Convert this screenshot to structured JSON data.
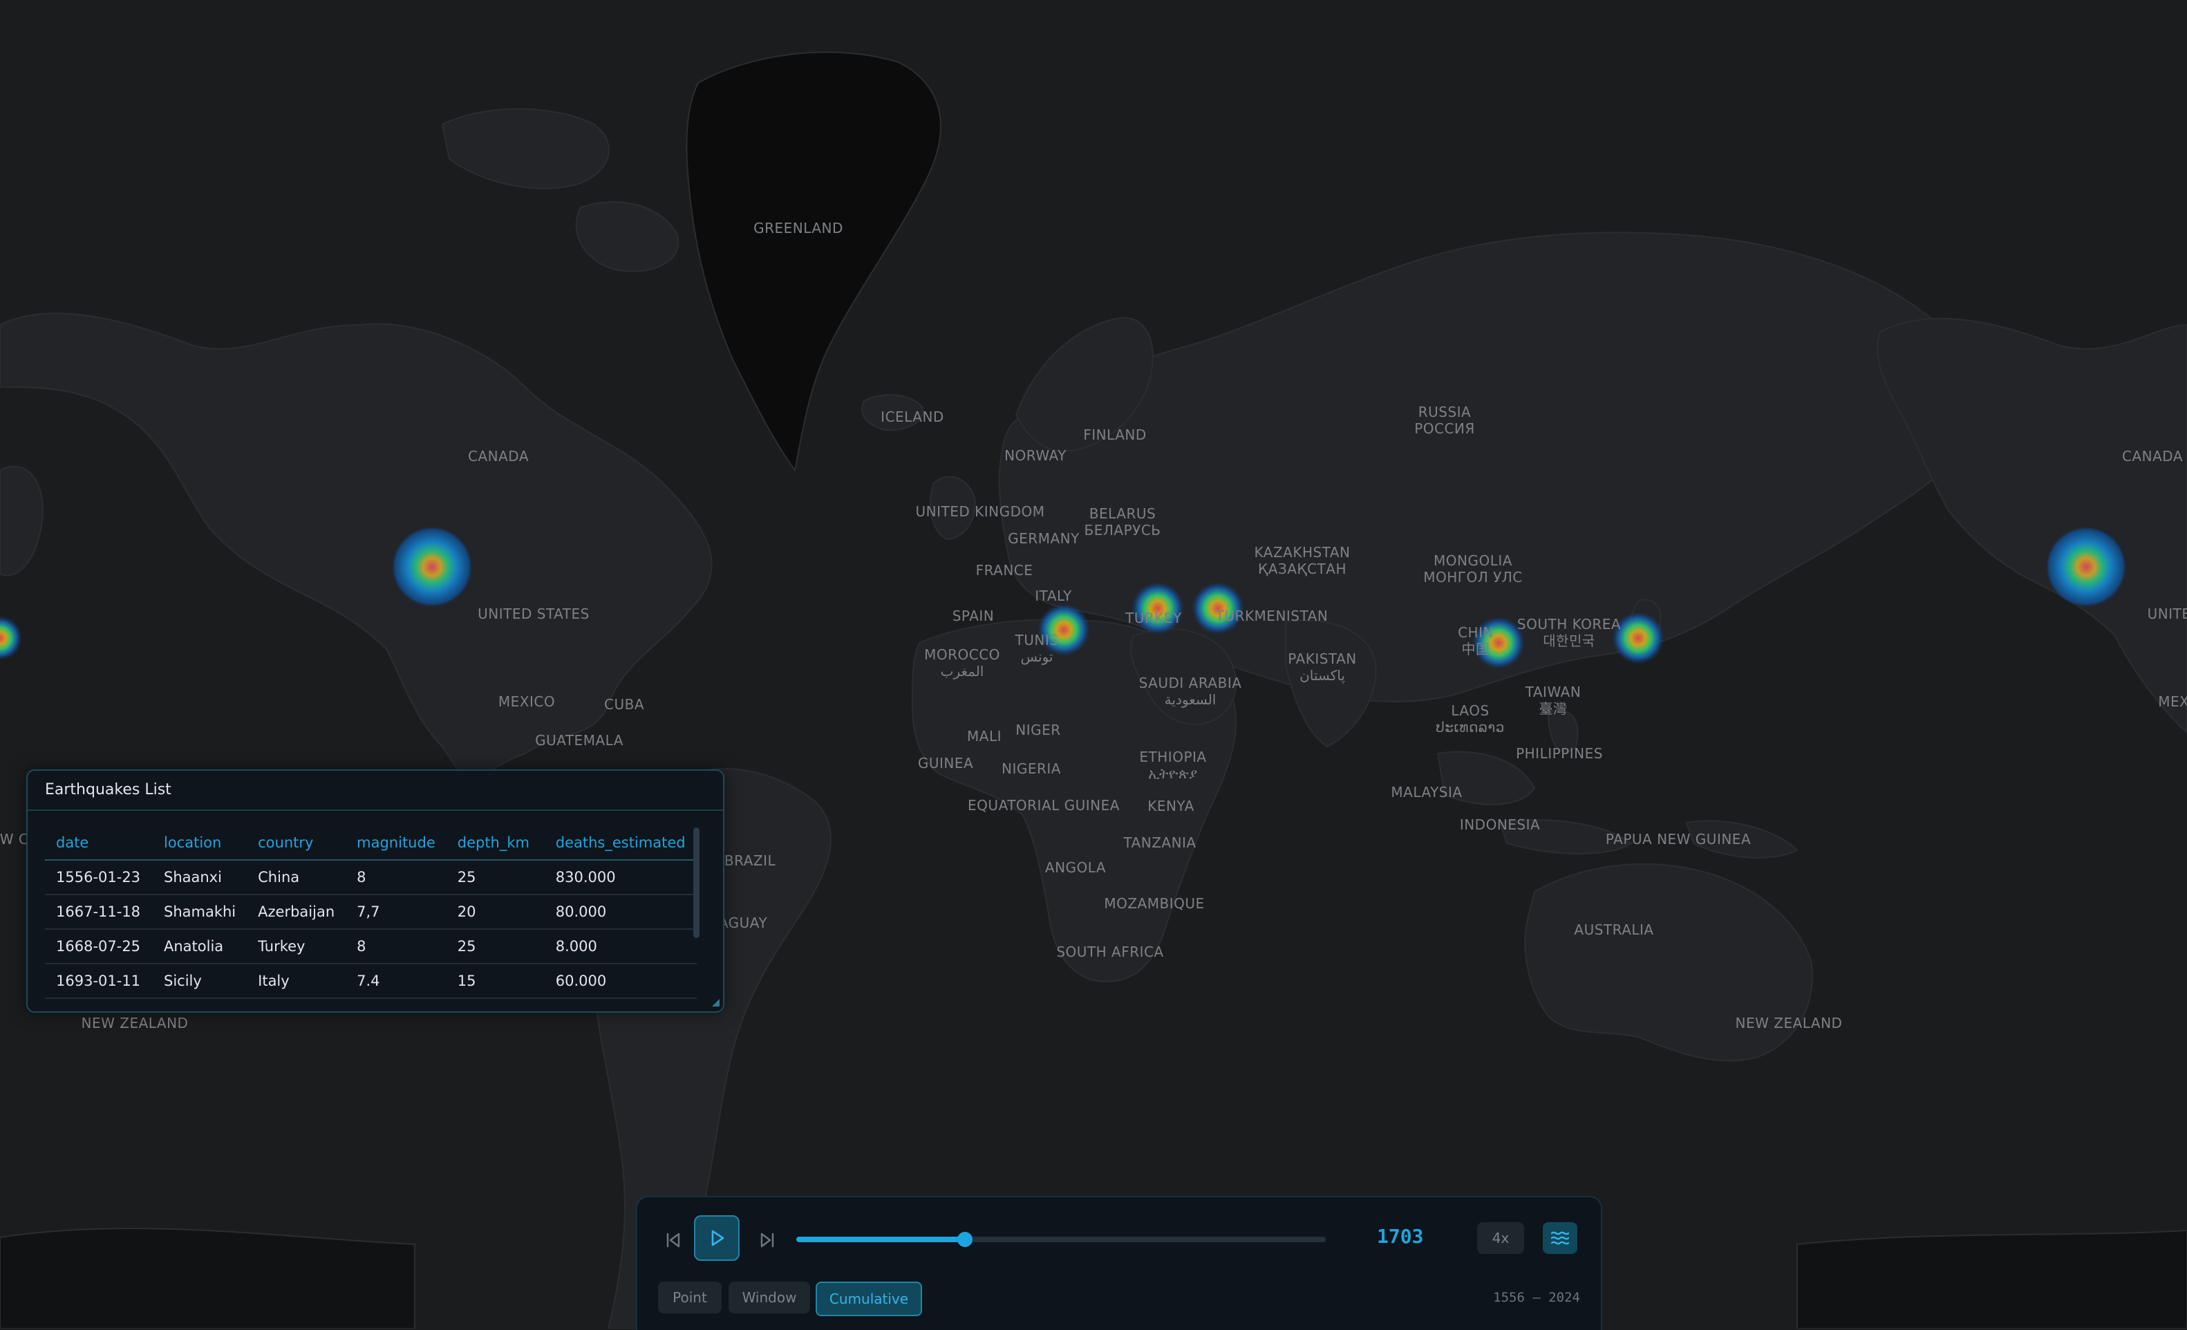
{
  "map": {
    "labels": [
      {
        "id": "greenland",
        "text": "GREENLAND"
      },
      {
        "id": "iceland",
        "text": "ICELAND"
      },
      {
        "id": "russia",
        "text": "RUSSIA\nРОССИЯ"
      },
      {
        "id": "canada",
        "text": "CANADA"
      },
      {
        "id": "canada-right",
        "text": "CANADA"
      },
      {
        "id": "norway",
        "text": "NORWAY"
      },
      {
        "id": "finland",
        "text": "FINLAND"
      },
      {
        "id": "united-kingdom",
        "text": "UNITED KINGDOM"
      },
      {
        "id": "belarus",
        "text": "BELARUS\nБЕЛАРУСЬ"
      },
      {
        "id": "germany",
        "text": "GERMANY"
      },
      {
        "id": "france",
        "text": "FRANCE"
      },
      {
        "id": "kazakhstan",
        "text": "KAZAKHSTAN\nҚАЗАҚСТАН"
      },
      {
        "id": "mongolia",
        "text": "MONGOLIA\nМОНГОЛ УЛС"
      },
      {
        "id": "italy",
        "text": "ITALY"
      },
      {
        "id": "spain",
        "text": "SPAIN"
      },
      {
        "id": "turkmenistan",
        "text": "TURKMENISTAN"
      },
      {
        "id": "tunisia",
        "text": "TUNIS\nتونس"
      },
      {
        "id": "morocco",
        "text": "MOROCCO\nالمغرب"
      },
      {
        "id": "turkey",
        "text": "TURKEY"
      },
      {
        "id": "pakistan",
        "text": "PAKISTAN\nپاکستان"
      },
      {
        "id": "china",
        "text": "CHIN\n中国"
      },
      {
        "id": "south-korea",
        "text": "SOUTH KOREA\n대한민국"
      },
      {
        "id": "united-states",
        "text": "UNITED STATES"
      },
      {
        "id": "united-states-right",
        "text": "UNITED"
      },
      {
        "id": "saudi-arabia",
        "text": "SAUDI ARABIA\nالسعودية"
      },
      {
        "id": "taiwan",
        "text": "TAIWAN\n臺灣"
      },
      {
        "id": "laos",
        "text": "LAOS\nປະເທດລາວ"
      },
      {
        "id": "mexico",
        "text": "MEXICO"
      },
      {
        "id": "mexico-right",
        "text": "MEXI"
      },
      {
        "id": "cuba",
        "text": "CUBA"
      },
      {
        "id": "guatemala",
        "text": "GUATEMALA"
      },
      {
        "id": "mali",
        "text": "MALI"
      },
      {
        "id": "niger",
        "text": "NIGER"
      },
      {
        "id": "ethiopia",
        "text": "ETHIOPIA\nኢትዮጵያ"
      },
      {
        "id": "guinea",
        "text": "GUINEA"
      },
      {
        "id": "nigeria",
        "text": "NIGERIA"
      },
      {
        "id": "philippines",
        "text": "PHILIPPINES"
      },
      {
        "id": "equatorial-guinea",
        "text": "EQUATORIAL GUINEA"
      },
      {
        "id": "kenya",
        "text": "KENYA"
      },
      {
        "id": "malaysia",
        "text": "MALAYSIA"
      },
      {
        "id": "indonesia",
        "text": "INDONESIA"
      },
      {
        "id": "papua-new-guinea",
        "text": "PAPUA NEW GUINEA"
      },
      {
        "id": "tanzania",
        "text": "TANZANIA"
      },
      {
        "id": "brazil",
        "text": "BRAZIL"
      },
      {
        "id": "angola",
        "text": "ANGOLA"
      },
      {
        "id": "mozambique",
        "text": "MOZAMBIQUE"
      },
      {
        "id": "australia",
        "text": "AUSTRALIA"
      },
      {
        "id": "south-africa",
        "text": "SOUTH AFRICA"
      },
      {
        "id": "new-zealand",
        "text": "NEW ZEALAND"
      },
      {
        "id": "new-zealand-right",
        "text": "NEW ZEALAND"
      },
      {
        "id": "paraguay",
        "text": "AGUAY"
      },
      {
        "id": "new-c",
        "text": "EW C"
      }
    ],
    "markers": [
      {
        "id": "sicily",
        "size": "small"
      },
      {
        "id": "anatolia",
        "size": "small"
      },
      {
        "id": "shamakhi",
        "size": "small"
      },
      {
        "id": "shaanxi",
        "size": "small"
      },
      {
        "id": "japan",
        "size": "small"
      },
      {
        "id": "us-west",
        "size": "large"
      },
      {
        "id": "us-west-wrap",
        "size": "large"
      },
      {
        "id": "left-edge",
        "size": "small"
      }
    ]
  },
  "earthquake_list": {
    "title": "Earthquakes List",
    "columns": [
      "date",
      "location",
      "country",
      "magnitude",
      "depth_km",
      "deaths_estimated"
    ],
    "rows": [
      [
        "1556-01-23",
        "Shaanxi",
        "China",
        "8",
        "25",
        "830.000"
      ],
      [
        "1667-11-18",
        "Shamakhi",
        "Azerbaijan",
        "7,7",
        "20",
        "80.000"
      ],
      [
        "1668-07-25",
        "Anatolia",
        "Turkey",
        "8",
        "25",
        "8.000"
      ],
      [
        "1693-01-11",
        "Sicily",
        "Italy",
        "7.4",
        "15",
        "60.000"
      ]
    ]
  },
  "playback": {
    "current_year": "1703",
    "progress_fraction": 0.3187,
    "speed_label": "4x",
    "modes": [
      "Point",
      "Window",
      "Cumulative"
    ],
    "active_mode": "Cumulative",
    "range_label": "1556 — 2024"
  },
  "icons": {
    "prev": "skip-back-icon",
    "play": "play-icon",
    "next": "skip-forward-icon",
    "heatmap": "heatmap-waves-icon"
  },
  "colors": {
    "accent": "#1ea5df",
    "background": "#1b1c1e",
    "land": "#232427",
    "panel": "#0f151c"
  }
}
